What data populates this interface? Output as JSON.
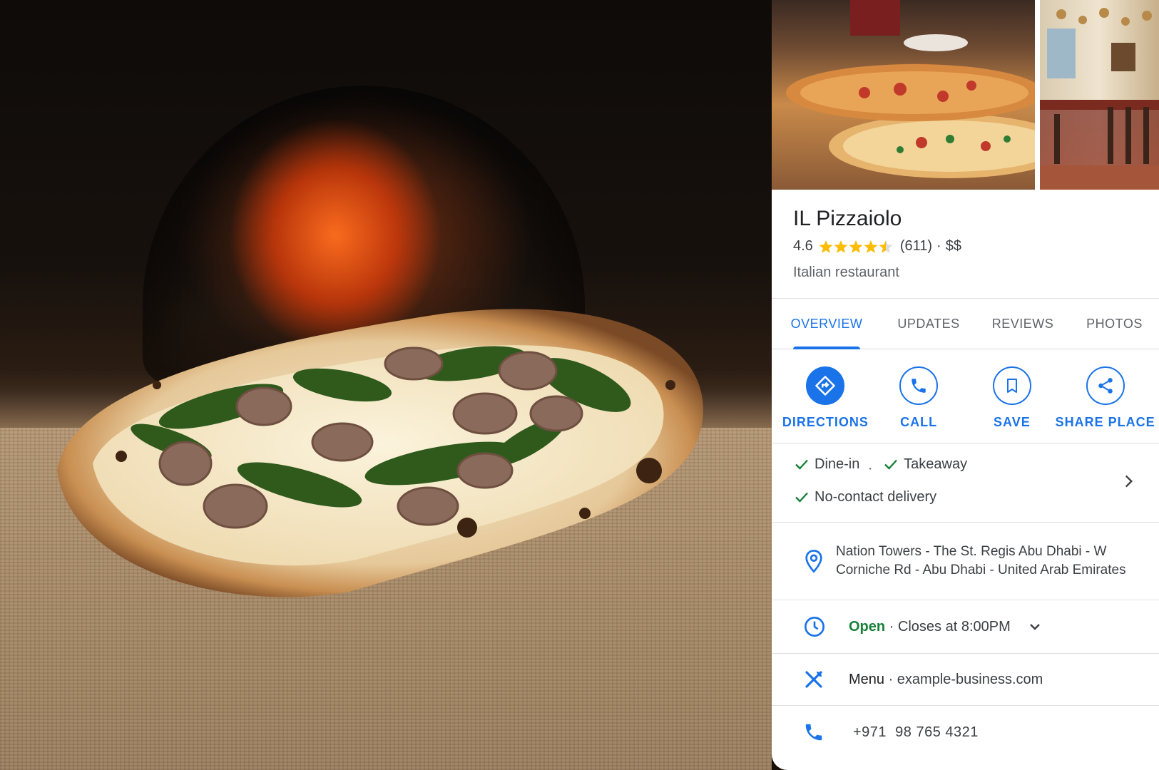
{
  "place": {
    "name": "IL Pizzaiolo",
    "rating": "4.6",
    "stars_value": 4.5,
    "reviews": "(611)",
    "separator": "·",
    "price": "$$",
    "category": "Italian restaurant"
  },
  "tabs": [
    {
      "label": "OVERVIEW",
      "active": true
    },
    {
      "label": "UPDATES",
      "active": false
    },
    {
      "label": "REVIEWS",
      "active": false
    },
    {
      "label": "PHOTOS",
      "active": false
    }
  ],
  "actions": {
    "directions": "DIRECTIONS",
    "call": "CALL",
    "save": "SAVE",
    "share": "SHARE PLACE"
  },
  "services": {
    "dine_in": "Dine-in",
    "takeaway": "Takeaway",
    "delivery": "No-contact delivery",
    "dot": "·"
  },
  "address": "Nation Towers - The St. Regis Abu Dhabi - W Corniche Rd - Abu Dhabi - United Arab Emirates",
  "hours": {
    "status": "Open",
    "detail": " · Closes at 8:00PM"
  },
  "menu": {
    "label": "Menu",
    "website": " · example-business.com"
  },
  "phone": "+971  98 765 4321",
  "colors": {
    "accent": "#1a73e8",
    "open": "#188038",
    "star": "#fbbc04",
    "check": "#188038"
  },
  "icons": [
    "directions-icon",
    "phone-icon",
    "bookmark-icon",
    "share-icon",
    "check-icon",
    "chevron-right-icon",
    "location-pin-icon",
    "clock-icon",
    "chevron-down-icon",
    "cutlery-icon",
    "phone-icon"
  ]
}
